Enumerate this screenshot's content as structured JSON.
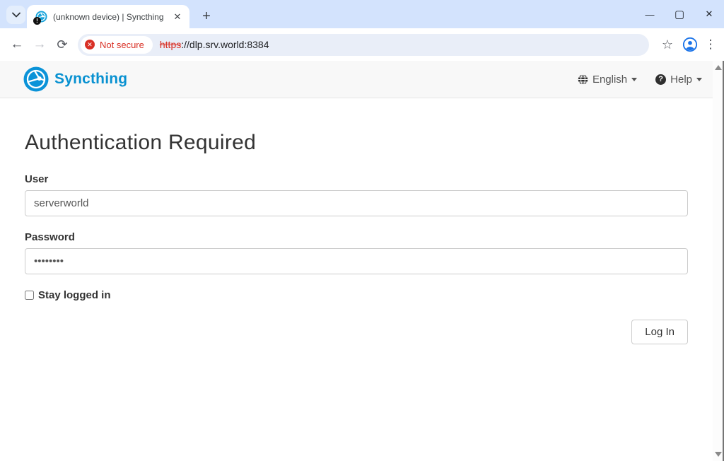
{
  "browser": {
    "tab_title": "(unknown device) | Syncthing",
    "security_badge": "Not secure",
    "url_scheme": "https",
    "url_rest": "://dlp.srv.world:8384"
  },
  "icons": {
    "favicon_badge": "!",
    "tab_close": "✕",
    "new_tab": "+",
    "back": "←",
    "forward": "→",
    "reload": "⟳",
    "not_secure_x": "✕",
    "bookmark_star": "☆",
    "menu_dots": "⋮",
    "minimize": "—",
    "maximize": "▢",
    "close_window": "✕",
    "help_question": "?"
  },
  "navbar": {
    "brand": "Syncthing",
    "language_label": "English",
    "help_label": "Help"
  },
  "login": {
    "title": "Authentication Required",
    "user_label": "User",
    "user_value": "serverworld",
    "password_label": "Password",
    "password_value": "••••••••",
    "stay_logged_in_label": "Stay logged in",
    "login_button_label": "Log In"
  },
  "colors": {
    "syncthing_blue": "#0891d1",
    "chrome_tabstrip": "#d3e3fd",
    "danger_red": "#d93025",
    "profile_blue": "#1a73e8"
  }
}
